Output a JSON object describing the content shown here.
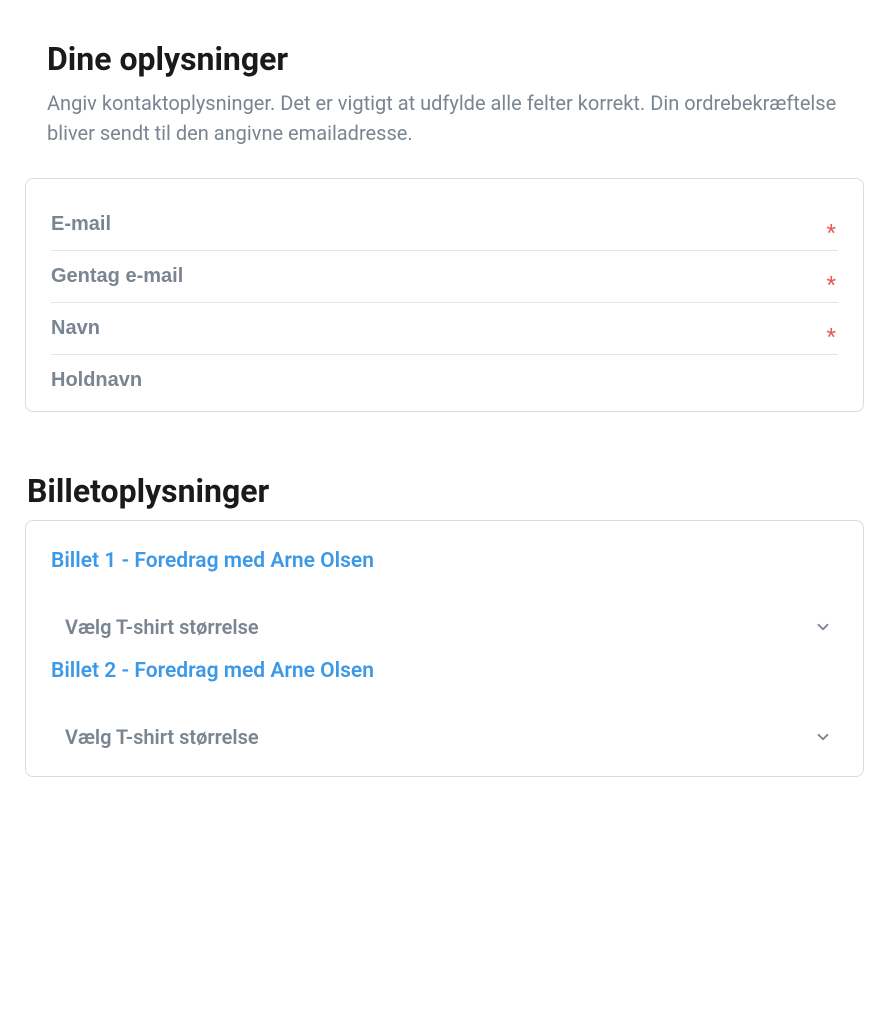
{
  "contact": {
    "title": "Dine oplysninger",
    "description": "Angiv kontaktoplysninger. Det er vigtigt at udfylde alle felter korrekt. Din ordrebekræftelse bliver sendt til den angivne emailadresse.",
    "fields": {
      "email": {
        "placeholder": "E-mail",
        "required": "*"
      },
      "email_repeat": {
        "placeholder": "Gentag e-mail",
        "required": "*"
      },
      "name": {
        "placeholder": "Navn",
        "required": "*"
      },
      "team_name": {
        "placeholder": "Holdnavn"
      }
    }
  },
  "tickets": {
    "title": "Billetoplysninger",
    "items": [
      {
        "label": "Billet 1 - Foredrag med Arne Olsen",
        "select_placeholder": "Vælg T-shirt størrelse"
      },
      {
        "label": "Billet 2 - Foredrag med Arne Olsen",
        "select_placeholder": "Vælg T-shirt størrelse"
      }
    ]
  }
}
